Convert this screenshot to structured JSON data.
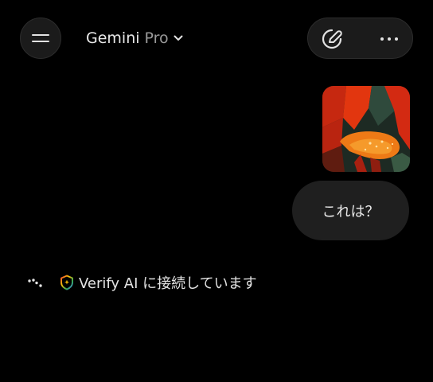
{
  "header": {
    "model_name": "Gemini",
    "model_tier": "Pro",
    "menu_icon": "hamburger-menu-icon",
    "dropdown_icon": "chevron-down-icon",
    "new_chat_icon": "new-chat-pen-icon",
    "more_icon": "more-horiz-icon"
  },
  "conversation": {
    "user_image": "photo-red-flower-petals-with-water-drops",
    "user_message": "これは？",
    "status": {
      "loading_icon": "sparkle-dots-icon",
      "shield_icon": "verify-shield-icon",
      "text": "Verify AI に接続しています"
    }
  },
  "theme": {
    "background": "#000000",
    "surface": "#1b1b1b",
    "bubble": "#1f1f1f",
    "text": "#e3e3e3",
    "muted": "#9a9a9a"
  }
}
